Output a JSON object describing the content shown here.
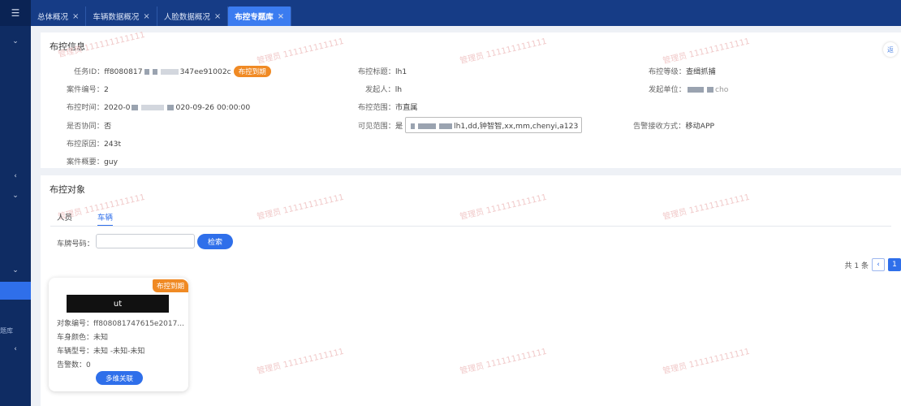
{
  "sidebar": {
    "menu_icon": "☰",
    "chevrons": [
      "⌄",
      "‹",
      "⌄",
      "⌄",
      "‹"
    ],
    "fragment_text": "题库"
  },
  "tabs": [
    {
      "label": "总体概况",
      "close": "×"
    },
    {
      "label": "车辆数据概况",
      "close": "×"
    },
    {
      "label": "人脸数据概况",
      "close": "×"
    },
    {
      "label": "布控专题库",
      "close": "×"
    }
  ],
  "info": {
    "title": "布控信息",
    "task_id_label": "任务ID：",
    "task_id_prefix": "ff8080817",
    "task_id_suffix": "347ee91002c",
    "status_badge": "布控到期",
    "case_no_label": "案件编号：",
    "case_no": "2",
    "time_label": "布控时间：",
    "time_start": "2020-0",
    "time_end": "020-09-26 00:00:00",
    "assist_label": "是否协同：",
    "assist": "否",
    "reason_label": "布控原因：",
    "reason": "243t",
    "summary_label": "案件概要：",
    "summary": "guy",
    "subject_label": "布控标题：",
    "subject": "lh1",
    "initiator_label": "发起人：",
    "initiator": "lh",
    "scope_label": "布控范围：",
    "scope": "市直属",
    "visible_label": "可见范围：",
    "visible_flag": "是",
    "visible_list": "lh1,dd,钟智智,xx,mm,chenyi,a123",
    "level_label": "布控等级：",
    "level": "查缉抓捕",
    "unit_label": "发起单位：",
    "unit": "cho",
    "alert_label": "告警接收方式：",
    "alert": "移动APP",
    "right_fragment": "返"
  },
  "objects": {
    "title": "布控对象",
    "tab_person": "人员",
    "tab_vehicle": "车辆",
    "plate_label": "车牌号码：",
    "plate_placeholder": "",
    "search_button": "检索",
    "pager_total": "共 1 条",
    "pager_prev": "‹",
    "pager_page": "1"
  },
  "card": {
    "badge": "布控到期",
    "plate": "ut",
    "object_no": "对象编号：ff808081747615e2017...",
    "color": "车身颜色：未知",
    "model": "车辆型号：未知 -未知-未知",
    "alerts": "告警数：0",
    "button": "多维关联"
  },
  "watermark": "管理员 111111111111",
  "colors": {
    "primary": "#2f6fea",
    "badge": "#f08a24",
    "nav": "#163c86"
  }
}
